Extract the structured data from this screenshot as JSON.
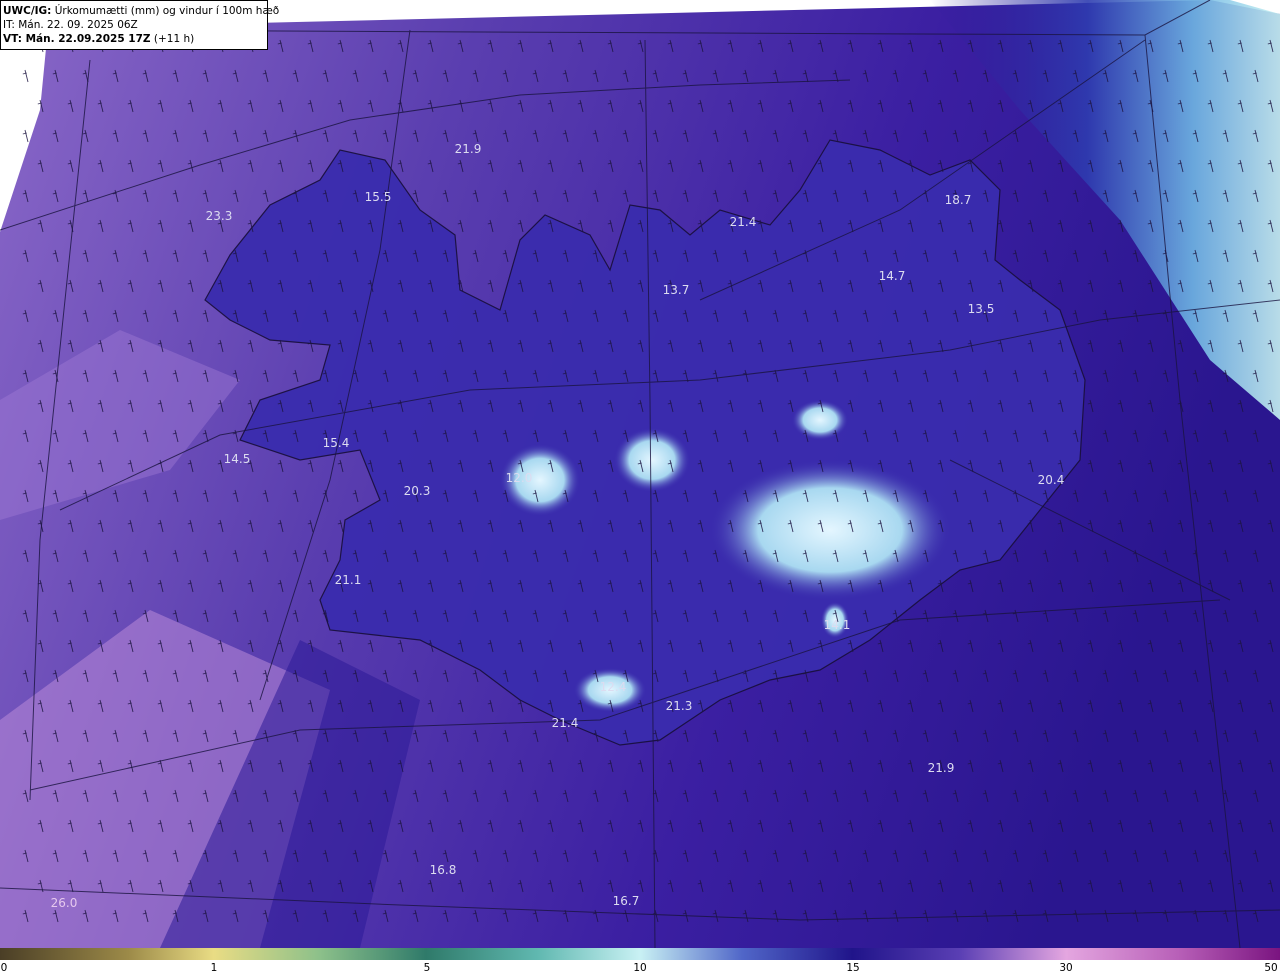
{
  "header": {
    "product_code": "UWC/IG:",
    "product_title": "Úrkomumætti (mm) og vindur í 100m hæð",
    "init_time": "IT: Mán. 22. 09. 2025 06Z",
    "valid_label": "VT: Mán. 22.09.2025 17Z",
    "valid_offset": "(+11 h)"
  },
  "map_values": [
    "21.9",
    "23.3",
    "15.5",
    "21.4",
    "18.7",
    "14.7",
    "13.7",
    "13.5",
    "14.5",
    "15.4",
    "20.3",
    "12.0",
    "20.4",
    "21.1",
    "14.1",
    "12.4",
    "21.3",
    "21.4",
    "21.9",
    "16.8",
    "16.7",
    "26.0"
  ],
  "colorbar": {
    "ticks": [
      "0",
      "1",
      "5",
      "10",
      "15",
      "30",
      "50"
    ],
    "colors": [
      "#5a4a2a",
      "#b9a55a",
      "#eee08a",
      "#3d8a7a",
      "#8fe0e0",
      "#d8f4f6",
      "#1e1a8c",
      "#3c2aa8",
      "#d18fd6",
      "#8a1f8a"
    ]
  }
}
